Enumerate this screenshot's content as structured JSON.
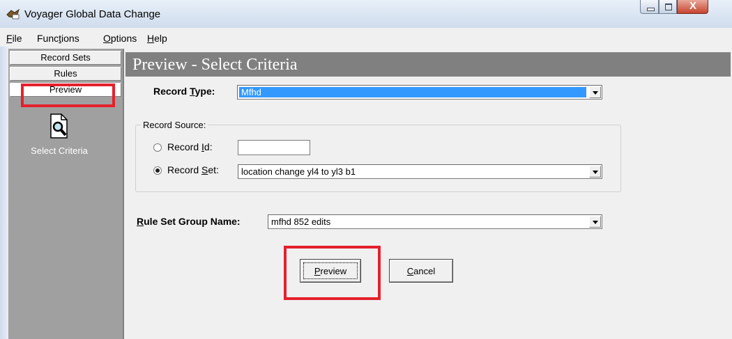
{
  "window": {
    "title": "Voyager Global Data Change"
  },
  "menu": [
    {
      "label": "File",
      "mnemonic": "F",
      "rest": "ile"
    },
    {
      "label": "Functions",
      "pre": "Func",
      "mnemonic": "t",
      "rest": "ions"
    },
    {
      "label": "Options",
      "mnemonic": "O",
      "rest": "ptions"
    },
    {
      "label": "Help",
      "mnemonic": "H",
      "rest": "elp"
    }
  ],
  "sidebar": {
    "tabs": [
      "Record Sets",
      "Rules",
      "Preview"
    ],
    "active_tab": "Preview",
    "item_label": "Select Criteria",
    "item_icon": "magnifier-document-icon"
  },
  "page": {
    "header": "Preview - Select Criteria"
  },
  "form": {
    "record_type": {
      "label_pre": "Record ",
      "label_mn": "T",
      "label_rest": "ype:",
      "value": "Mfhd"
    },
    "record_source": {
      "legend": "Record Source:",
      "record_id": {
        "label_pre": "Record ",
        "label_mn": "I",
        "label_rest": "d:",
        "value": "",
        "checked": false
      },
      "record_set": {
        "label_pre": "Record ",
        "label_mn": "S",
        "label_rest": "et:",
        "value": "location change yl4 to yl3 b1",
        "checked": true
      }
    },
    "rule_set_group": {
      "label_mn": "R",
      "label_rest": "ule Set Group Name:",
      "value": "mfhd 852 edits"
    },
    "buttons": {
      "preview": {
        "mn": "P",
        "rest": "review"
      },
      "cancel": {
        "mn": "C",
        "rest": "ancel"
      }
    }
  },
  "colors": {
    "highlight": "#e5202c",
    "selection": "#3399ff",
    "header_band": "#808080",
    "sidebar": "#a0a0a0"
  }
}
